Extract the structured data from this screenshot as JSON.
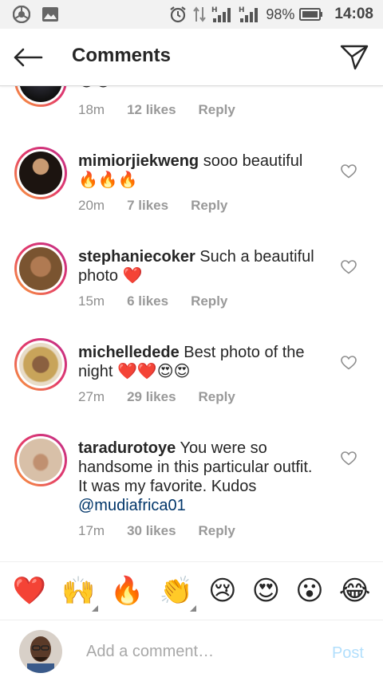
{
  "status_bar": {
    "battery_percent": "98%",
    "time": "14:08",
    "icons": [
      "chrome-icon",
      "gallery-icon",
      "alarm-icon",
      "data-transfer-icon",
      "signal-h-icon",
      "signal-h-icon",
      "battery-icon"
    ]
  },
  "header": {
    "title": "Comments",
    "back_icon": "arrow-left-icon",
    "send_icon": "paper-plane-icon"
  },
  "comments": [
    {
      "username": "",
      "text": "",
      "emoji": "😍😍",
      "time": "18m",
      "likes": "12 likes",
      "reply": "Reply"
    },
    {
      "username": "mimiorjiekweng",
      "text": "sooo beautiful",
      "emoji": "🔥🔥🔥",
      "time": "20m",
      "likes": "7 likes",
      "reply": "Reply"
    },
    {
      "username": "stephaniecoker",
      "text": "Such a beautiful photo",
      "emoji": "❤️",
      "time": "15m",
      "likes": "6 likes",
      "reply": "Reply"
    },
    {
      "username": "michelledede",
      "text": "Best photo of the night",
      "emoji": "❤️❤️😍😍",
      "time": "27m",
      "likes": "29 likes",
      "reply": "Reply"
    },
    {
      "username": "taradurotoye",
      "text": "You were so handsome in this particular outfit. It was my favorite. Kudos",
      "mention": "@mudiafrica01",
      "time": "17m",
      "likes": "30 likes",
      "reply": "Reply"
    }
  ],
  "emoji_bar": [
    "❤️",
    "🙌",
    "🔥",
    "👏",
    "😢",
    "😍",
    "😮",
    "😂"
  ],
  "composer": {
    "placeholder": "Add a comment…",
    "post_label": "Post"
  },
  "colors": {
    "story_ring_start": "#f9a13a",
    "story_ring_end": "#c02f8a",
    "mention": "#003569",
    "post_disabled": "#b2dffc",
    "meta_gray": "#8e8e8e"
  }
}
